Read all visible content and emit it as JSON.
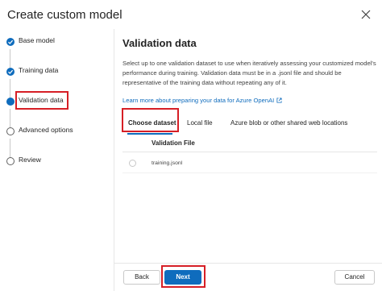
{
  "dialog": {
    "title": "Create custom model"
  },
  "steps": [
    {
      "label": "Base model",
      "state": "done"
    },
    {
      "label": "Training data",
      "state": "done"
    },
    {
      "label": "Validation data",
      "state": "current"
    },
    {
      "label": "Advanced options",
      "state": "pending"
    },
    {
      "label": "Review",
      "state": "pending"
    }
  ],
  "main": {
    "title": "Validation data",
    "description": "Select up to one validation dataset to use when iteratively assessing your customized model's performance during training. Validation data must be in a .jsonl file and should be representative of the training data without repeating any of it.",
    "link": "Learn more about preparing your data for Azure OpenAI",
    "tabs": [
      "Choose dataset",
      "Local file",
      "Azure blob or other shared web locations"
    ],
    "selected_tab": "Choose dataset",
    "table": {
      "columns": [
        "Validation File"
      ],
      "rows": [
        [
          "training.jsonl"
        ]
      ]
    }
  },
  "footer": {
    "back_label": "Back",
    "next_label": "Next",
    "cancel_label": "Cancel"
  },
  "colors": {
    "accent": "#0f6cbd",
    "highlight": "#d61f26"
  }
}
